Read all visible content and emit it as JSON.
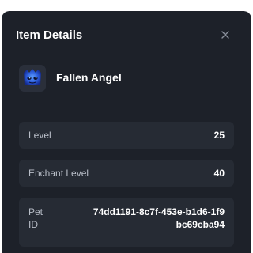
{
  "modal": {
    "title": "Item Details",
    "close_icon": "close-icon"
  },
  "item": {
    "name": "Fallen Angel",
    "icon": "pet-thumbnail-icon",
    "icon_colors": [
      "#1b3fb5",
      "#3b7bea"
    ]
  },
  "fields": [
    {
      "label": "Level",
      "value": "25"
    },
    {
      "label": "Enchant Level",
      "value": "40"
    },
    {
      "label": "Pet ID",
      "value": "74dd1191-8c7f-453e-b1d6-1f9bc69cba94"
    }
  ],
  "colors": {
    "panel_bg": "#1d2129",
    "field_bg": "#262b34",
    "label_text": "#b9bec8",
    "value_text": "#ffffff"
  }
}
